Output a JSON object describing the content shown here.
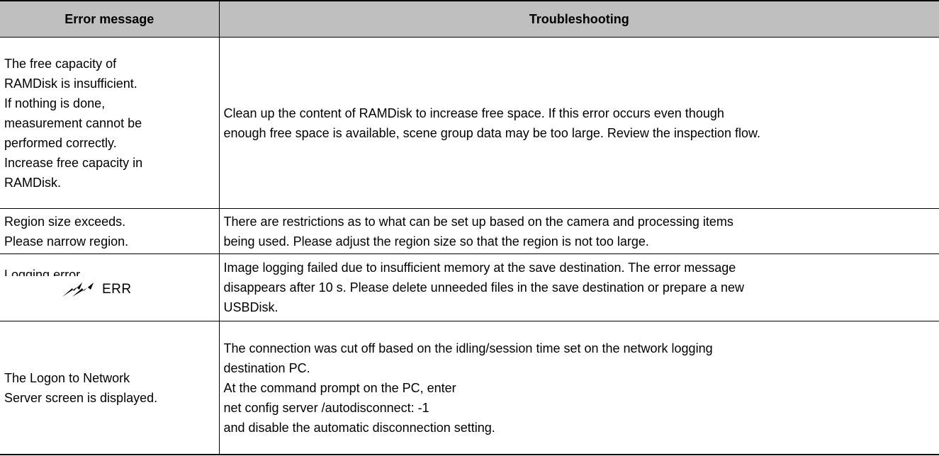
{
  "header": {
    "col1": "Error message",
    "col2": "Troubleshooting"
  },
  "rows": [
    {
      "message_lines": [
        "The free capacity of",
        "RAMDisk is insufficient.",
        "If nothing is done,",
        "measurement cannot be",
        "performed correctly.",
        "Increase free capacity in",
        "RAMDisk."
      ],
      "fix_lines": [
        "Clean up the content of RAMDisk to increase free space. If this error occurs even though",
        "enough free space is available, scene group data may be too large. Review the inspection flow."
      ]
    },
    {
      "message_lines": [
        "Region size exceeds.",
        "Please narrow region."
      ],
      "fix_lines": [
        "There are restrictions as to what can be set up based on the camera and processing items",
        "being used. Please adjust the region size so that the region is not too large."
      ]
    },
    {
      "message_lines": [
        "Logging error"
      ],
      "indicator_icon": "lightning-err-icon",
      "indicator_text": "ERR",
      "fix_lines": [
        "Image logging failed due to insufficient memory at the save destination. The error message",
        "disappears after 10 s. Please delete unneeded files in the save destination or prepare a new",
        "USBDisk."
      ]
    },
    {
      "message_lines": [
        "The Logon to Network",
        "Server screen is displayed."
      ],
      "fix_lines": [
        "The connection was cut off based on the idling/session time set on the network logging",
        "destination PC.",
        "At the command prompt on the PC, enter",
        "net config server /autodisconnect: -1",
        "and disable the automatic disconnection setting."
      ]
    }
  ]
}
